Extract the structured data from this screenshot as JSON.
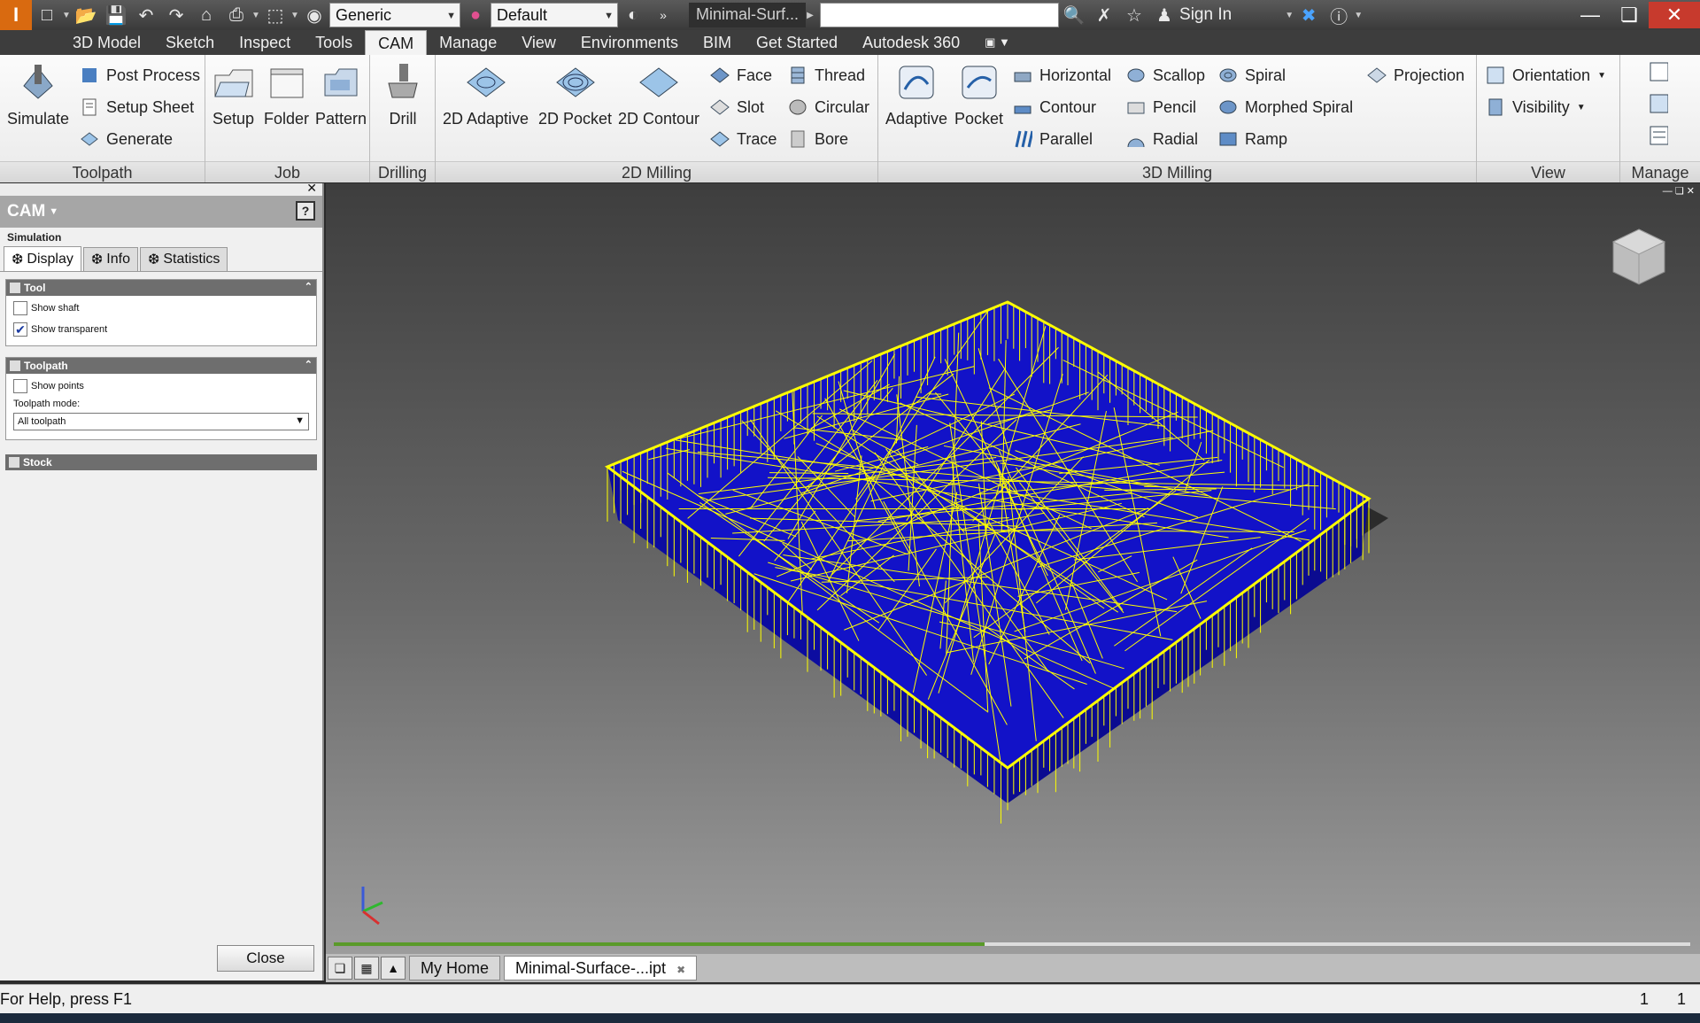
{
  "quick_access": {
    "appearance_combo": "Generic",
    "material_combo": "Default",
    "document_title": "Minimal-Surf...",
    "sign_in": "Sign In"
  },
  "ribbon_tabs": [
    "3D Model",
    "Sketch",
    "Inspect",
    "Tools",
    "CAM",
    "Manage",
    "View",
    "Environments",
    "BIM",
    "Get Started",
    "Autodesk 360"
  ],
  "active_tab": "CAM",
  "panels": {
    "toolpath": {
      "label": "Toolpath",
      "simulate": "Simulate",
      "post_process": "Post Process",
      "setup_sheet": "Setup Sheet",
      "generate": "Generate"
    },
    "job": {
      "label": "Job",
      "setup": "Setup",
      "folder": "Folder",
      "pattern": "Pattern"
    },
    "drilling": {
      "label": "Drilling",
      "drill": "Drill"
    },
    "milling2d": {
      "label": "2D Milling",
      "adaptive": "2D Adaptive",
      "pocket": "2D Pocket",
      "contour": "2D Contour",
      "face": "Face",
      "slot": "Slot",
      "trace": "Trace",
      "thread": "Thread",
      "circular": "Circular",
      "bore": "Bore"
    },
    "milling3d": {
      "label": "3D Milling",
      "adaptive": "Adaptive",
      "pocket": "Pocket",
      "horizontal": "Horizontal",
      "contour": "Contour",
      "parallel": "Parallel",
      "scallop": "Scallop",
      "pencil": "Pencil",
      "radial": "Radial",
      "spiral": "Spiral",
      "morphed_spiral": "Morphed Spiral",
      "ramp": "Ramp",
      "projection": "Projection"
    },
    "view": {
      "label": "View",
      "orientation": "Orientation",
      "visibility": "Visibility"
    },
    "manage": {
      "label": "Manage"
    }
  },
  "browser": {
    "title": "CAM",
    "subtitle": "Simulation",
    "tabs": [
      "Display",
      "Info",
      "Statistics"
    ],
    "tool_group": {
      "title": "Tool",
      "show_shaft": "Show shaft",
      "show_shaft_checked": false,
      "show_transparent": "Show transparent",
      "show_transparent_checked": true
    },
    "toolpath_group": {
      "title": "Toolpath",
      "show_points": "Show points",
      "show_points_checked": false,
      "mode_label": "Toolpath mode:",
      "mode_value": "All toolpath"
    },
    "stock_group": {
      "title": "Stock"
    },
    "close": "Close"
  },
  "simulation_progress": 0.48,
  "document_tabs": {
    "home": "My Home",
    "part": "Minimal-Surface-...ipt"
  },
  "status": {
    "help": "For Help, press F1",
    "count1": "1",
    "count2": "1"
  },
  "colors": {
    "toolpath": "#ffff00",
    "surface": "#1a1acc",
    "accent": "#d96a10"
  }
}
